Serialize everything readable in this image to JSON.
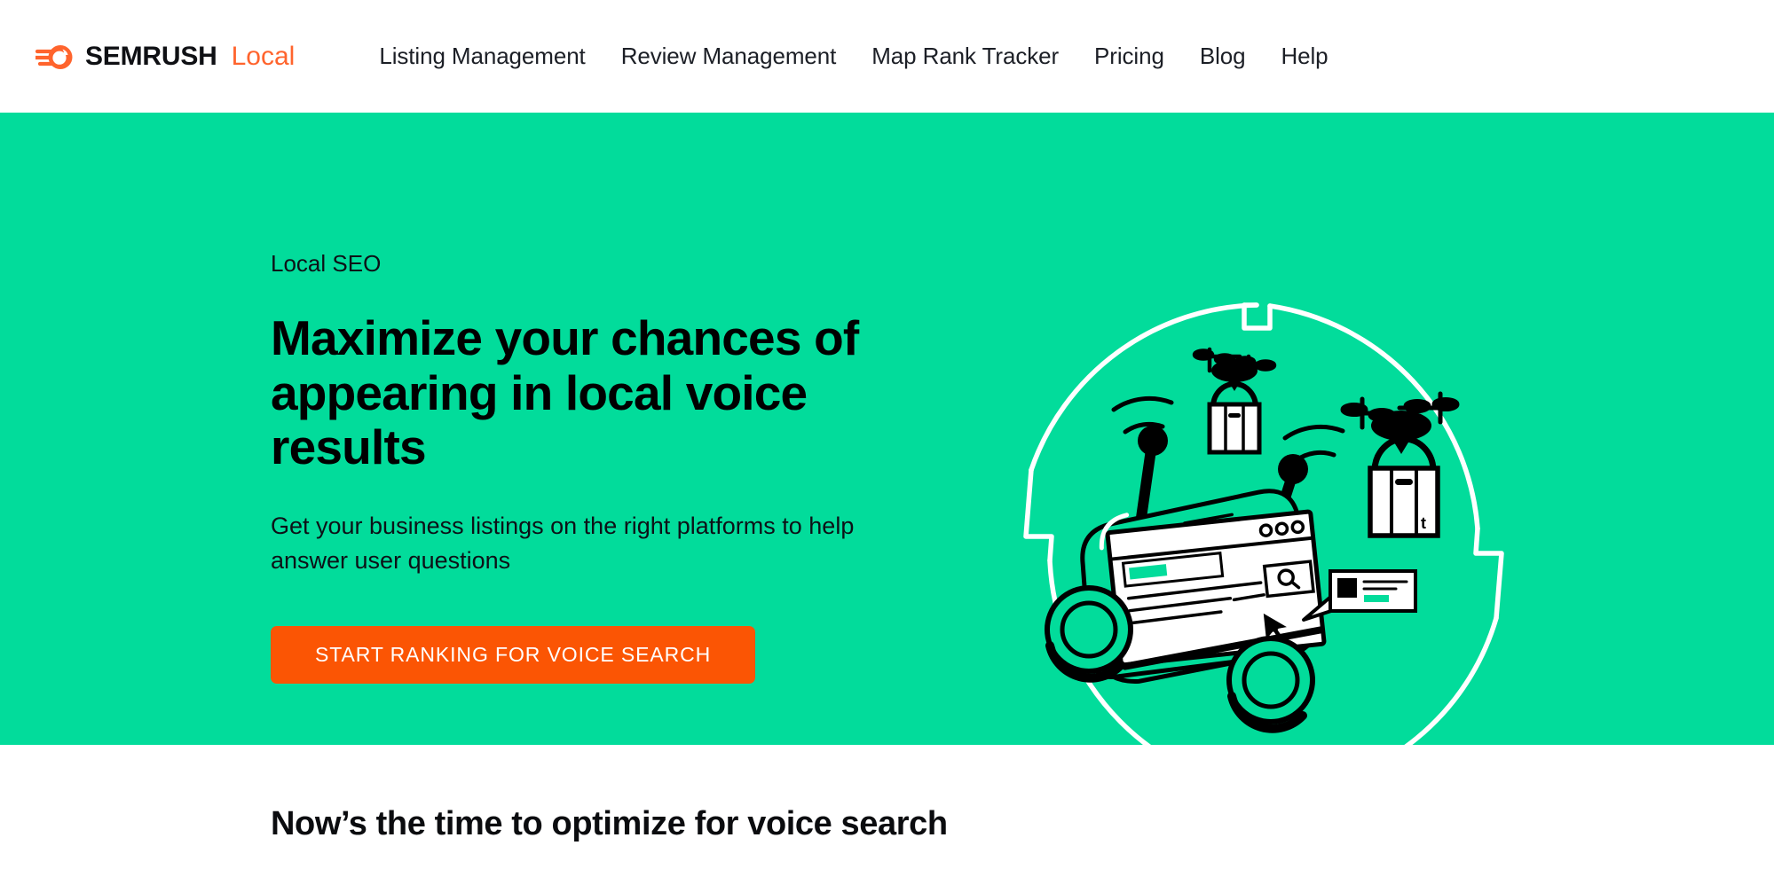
{
  "header": {
    "brand": {
      "logo_icon": "semrush-comet-icon",
      "name": "SEMRUSH",
      "product": "Local",
      "name_color": "#0f1014",
      "product_color": "#ff642d",
      "icon_color": "#ff642d"
    },
    "nav": [
      {
        "label": "Listing Management",
        "name": "nav-link-listing-management"
      },
      {
        "label": "Review Management",
        "name": "nav-link-review-management"
      },
      {
        "label": "Map Rank Tracker",
        "name": "nav-link-map-rank-tracker"
      },
      {
        "label": "Pricing",
        "name": "nav-link-pricing"
      },
      {
        "label": "Blog",
        "name": "nav-link-blog"
      },
      {
        "label": "Help",
        "name": "nav-link-help"
      }
    ],
    "background": "#ffffff",
    "text_color": "#1c1f26"
  },
  "hero": {
    "background": "#02dc9b",
    "eyebrow": "Local SEO",
    "title_line_1": "Maximize your chances of",
    "title_line_2": "appearing in local voice results",
    "subtitle": "Get your business listings on the right platforms to help answer user questions",
    "cta_label": "START RANKING FOR VOICE SEARCH",
    "cta_background": "#fb5504",
    "cta_text_color": "#ffffff",
    "title_color": "#000000",
    "illustration": {
      "name": "delivery-robot-voice-search-illustration",
      "ring_color": "#ffffff",
      "line_color": "#000000",
      "fill_color": "#ffffff",
      "accent_color": "#02dc9b",
      "elements": [
        "notched-circle-ring",
        "delivery-rover-robot",
        "browser-window-screen",
        "search-magnifier-icon",
        "cursor-pointer-icon",
        "antenna-left",
        "antenna-right",
        "signal-waves-left",
        "signal-waves-right",
        "drone-small-with-shopping-bag",
        "drone-large-with-shopping-bag",
        "speech-bubble-card",
        "wheel-left",
        "wheel-right"
      ],
      "shopping_bag_mark": "t"
    }
  },
  "below_section": {
    "background": "#ffffff",
    "title": "Now’s the time to optimize for voice search",
    "title_color": "#0b0c0f"
  }
}
